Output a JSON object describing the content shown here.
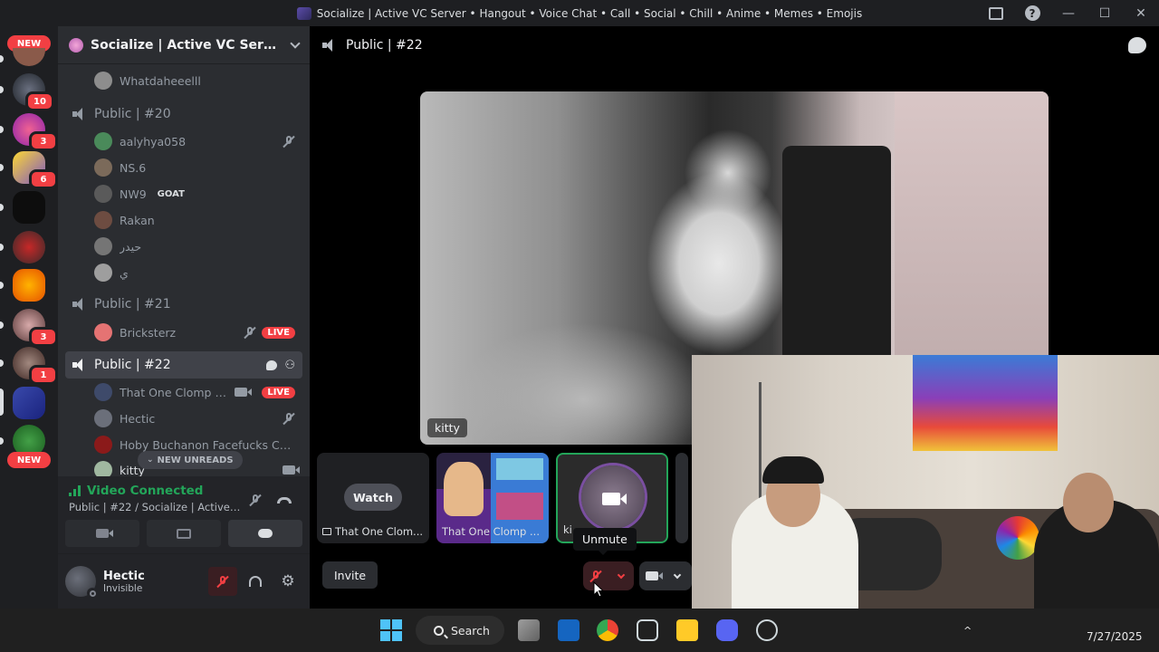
{
  "window": {
    "title": "Socialize | Active VC Server • Hangout • Voice Chat • Call • Social • Chill • Anime • Memes • Emojis"
  },
  "rail": {
    "new_label": "NEW",
    "badges": [
      "10",
      "3",
      "6",
      "3",
      "1"
    ]
  },
  "server": {
    "name": "Socialize | Active VC Server • H..."
  },
  "channels": [
    {
      "name": "Public | #20",
      "users": [
        {
          "name": "aalyhya058",
          "muted": true
        },
        {
          "name": "NS.6"
        },
        {
          "name": "NW9",
          "tag": "GOAT"
        },
        {
          "name": "Rakan"
        },
        {
          "name": "حيدر"
        },
        {
          "name": "ي"
        }
      ]
    },
    {
      "name": "Public | #21",
      "users": [
        {
          "name": "Bricksterz",
          "muted": true,
          "live": "LIVE"
        }
      ]
    },
    {
      "name": "Public | #22",
      "users": [
        {
          "name": "That One Clomp With ...",
          "live": "LIVE"
        },
        {
          "name": "Hectic",
          "muted": true
        },
        {
          "name": "Hoby Buchanon Facefucks Chicks"
        },
        {
          "name": "kitty"
        }
      ]
    }
  ],
  "prev_user": "Whatdaheeelll",
  "new_unreads": "NEW UNREADS",
  "voice": {
    "status": "Video Connected",
    "location": "Public | #22 / Socialize | Active VC Server • ..."
  },
  "user": {
    "name": "Hectic",
    "status": "Invisible"
  },
  "main": {
    "channel": "Public | #22",
    "stage_name": "kitty",
    "tiles": [
      {
        "label": "That One Clom...",
        "watch": "Watch"
      },
      {
        "label": "That One Clomp ..."
      },
      {
        "label": "ki"
      }
    ],
    "tooltip": "Unmute",
    "invite": "Invite"
  },
  "taskbar": {
    "search": "Search",
    "date": "7/27/2025"
  },
  "colors": {
    "accent_green": "#23a559",
    "live_red": "#f23f43",
    "sidebar_bg": "#2b2d31"
  }
}
